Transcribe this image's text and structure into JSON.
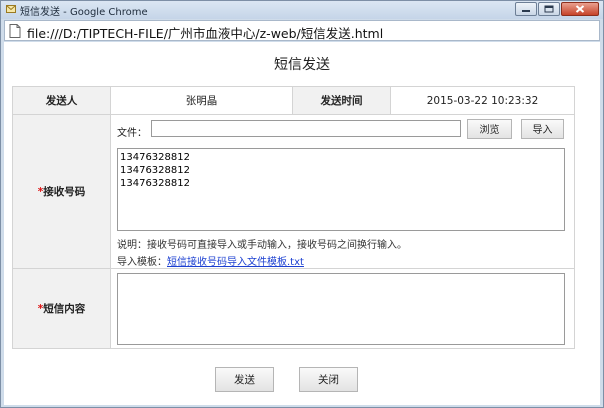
{
  "window": {
    "title": "短信发送 - Google Chrome",
    "url": "file:///D:/TIPTECH-FILE/广州市血液中心/z-web/短信发送.html"
  },
  "page": {
    "title": "短信发送",
    "sender_label": "发送人",
    "sender_value": "张明晶",
    "time_label": "发送时间",
    "time_value": "2015-03-22 10:23:32",
    "required_mark": "*",
    "receiver_label": "接收号码",
    "file_label": "文件：",
    "file_value": "",
    "browse_label": "浏览",
    "import_label": "导入",
    "receiver_numbers": "13476328812\n13476328812\n13476328812",
    "hint": "说明：接收号码可直接导入或手动输入，接收号码之间换行输入。",
    "template_prefix": "导入模板：",
    "template_link": "短信接收号码导入文件模板.txt",
    "content_label": "短信内容",
    "content_value": "",
    "send_label": "发送",
    "close_label": "关闭"
  },
  "colors": {
    "required": "#dd1111",
    "link": "#1b3fd1",
    "label_bg": "#f1f1f1"
  }
}
